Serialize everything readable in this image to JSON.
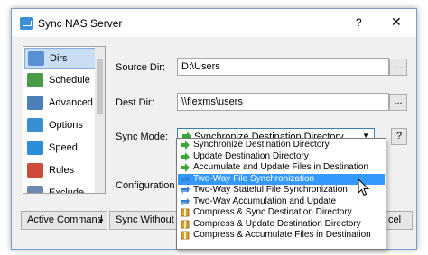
{
  "window": {
    "title": "Sync NAS Server",
    "help_glyph": "?",
    "close_glyph": "✕"
  },
  "nav": {
    "items": [
      {
        "label": "Dirs",
        "icon": "folder-icon",
        "color": "#5b8fd4",
        "selected": true
      },
      {
        "label": "Schedule",
        "icon": "calendar-clock-icon",
        "color": "#4a9a4a",
        "selected": false
      },
      {
        "label": "Advanced",
        "icon": "advanced-gears-icon",
        "color": "#4a7fb8",
        "selected": false
      },
      {
        "label": "Options",
        "icon": "options-list-icon",
        "color": "#3a8fd0",
        "selected": false
      },
      {
        "label": "Speed",
        "icon": "speed-gauge-icon",
        "color": "#2b8fd8",
        "selected": false
      },
      {
        "label": "Rules",
        "icon": "rules-icon",
        "color": "#d04a3a",
        "selected": false
      },
      {
        "label": "Exclude",
        "icon": "exclude-icon",
        "color": "#6a8ab0",
        "selected": false
      }
    ]
  },
  "form": {
    "source_label": "Source Dir:",
    "source_value": "D:\\Users",
    "dest_label": "Dest Dir:",
    "dest_value": "\\\\flexms\\users",
    "browse_label": "...",
    "sync_mode_label": "Sync Mode:",
    "sync_mode_value": "Synchronize Destination Directory",
    "help_label": "?",
    "config_label": "Configuration Mo"
  },
  "buttons": {
    "active_command": "Active Command",
    "sync_without_preview": "Sync Without Previ",
    "cancel_fragment": "cel"
  },
  "dropdown": {
    "options": [
      {
        "label": "Synchronize Destination Directory",
        "icon": "green-arrow-icon",
        "color": "#3aa53a",
        "highlighted": false
      },
      {
        "label": "Update Destination Directory",
        "icon": "green-arrow-icon",
        "color": "#3aa53a",
        "highlighted": false
      },
      {
        "label": "Accumulate and Update Files in Destination",
        "icon": "green-arrow-icon",
        "color": "#3aa53a",
        "highlighted": false
      },
      {
        "label": "Two-Way File Synchronization",
        "icon": "two-way-sync-icon",
        "color": "#2f7fd0",
        "highlighted": true
      },
      {
        "label": "Two-Way Stateful File Synchronization",
        "icon": "two-way-sync-icon",
        "color": "#2f7fd0",
        "highlighted": false
      },
      {
        "label": "Two-Way Accumulation and Update",
        "icon": "two-way-sync-icon",
        "color": "#2f7fd0",
        "highlighted": false
      },
      {
        "label": "Compress & Sync Destination Directory",
        "icon": "compress-archive-icon",
        "color": "#e0a030",
        "highlighted": false
      },
      {
        "label": "Compress & Update Destination Directory",
        "icon": "compress-archive-icon",
        "color": "#e0a030",
        "highlighted": false
      },
      {
        "label": "Compress & Accumulate Files in Destination",
        "icon": "compress-archive-icon",
        "color": "#e0a030",
        "highlighted": false
      }
    ]
  },
  "colors": {
    "highlight": "#3399ff",
    "selected_nav": "#c9def5"
  }
}
